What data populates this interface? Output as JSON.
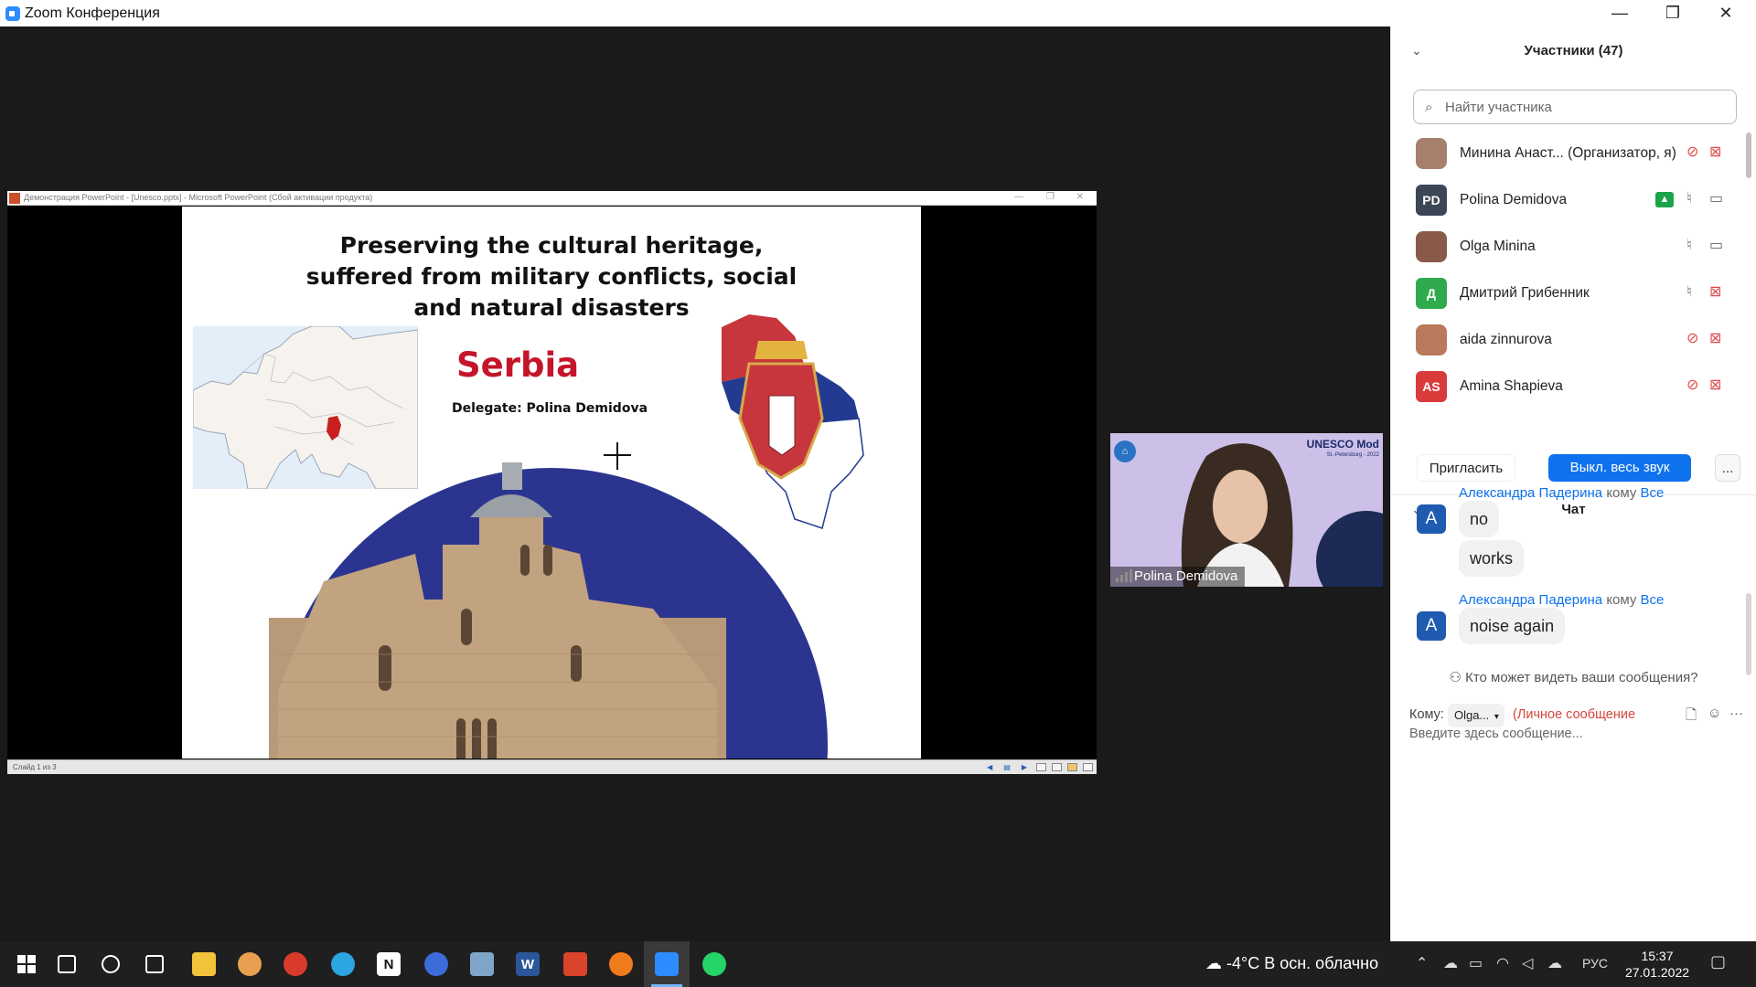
{
  "window": {
    "title": "Zoom Конференция",
    "controls": {
      "minimize": "—",
      "restore": "❐",
      "close": "✕"
    }
  },
  "powerpoint": {
    "title": "Демонстрация PowerPoint - [Unesco.pptx] - Microsoft PowerPoint (Сбой активации продукта)",
    "status": "Слайд 1 из 3",
    "slide": {
      "title_line1": "Preserving the cultural heritage,",
      "title_line2": "suffered from military conflicts, social",
      "title_line3": "and natural disasters",
      "country": "Serbia",
      "delegate": "Delegate: Polina Demidova"
    }
  },
  "video": {
    "name": "Polina Demidova",
    "brand": "UNESCO Mod",
    "brand_sub": "St.-Petersburg - 2022"
  },
  "participants": {
    "header": "Участники (47)",
    "search_placeholder": "Найти участника",
    "items": [
      {
        "name": "Минина Анаст...  (Организатор, я)",
        "avatar": "photo",
        "color": "#a7806c",
        "mic": "muted",
        "cam": "off"
      },
      {
        "name": "Polina Demidova",
        "avatar": "PD",
        "color": "#3b4757",
        "mic": "on",
        "cam": "on",
        "sharing": true
      },
      {
        "name": "Olga Minina",
        "avatar": "photo",
        "color": "#8a5a48",
        "mic": "on",
        "cam": "on"
      },
      {
        "name": "Дмитрий Грибенник",
        "avatar": "Д",
        "color": "#2faa4c",
        "mic": "on",
        "cam": "off"
      },
      {
        "name": "aida zinnurova",
        "avatar": "photo",
        "color": "#b87a5a",
        "mic": "muted",
        "cam": "off"
      },
      {
        "name": "Amina Shapieva",
        "avatar": "AS",
        "color": "#d93b3b",
        "mic": "muted",
        "cam": "off"
      }
    ],
    "buttons": {
      "invite": "Пригласить",
      "mute_all": "Выкл. весь звук",
      "more": "..."
    }
  },
  "chat": {
    "header": "Чат",
    "messages": [
      {
        "sender": "Александра Падерина",
        "to_word": "кому",
        "recipient": "Все",
        "avatar": "A",
        "bubbles": [
          "no",
          "works"
        ]
      },
      {
        "sender": "Александра Падерина",
        "to_word": "кому",
        "recipient": "Все",
        "avatar": "A",
        "bubbles": [
          "noise again"
        ]
      }
    ],
    "who_can_see": "Кто может видеть ваши сообщения?",
    "to_label": "Кому:",
    "to_value": "Olga...",
    "private": "(Личное сообщение",
    "input_placeholder": "Введите здесь сообщение..."
  },
  "taskbar": {
    "weather": "-4°C  В осн. облачно",
    "lang": "РУС",
    "time": "15:37",
    "date": "27.01.2022",
    "apps": [
      {
        "icon": "windows-start-icon",
        "color": "#ffffff",
        "label": ""
      },
      {
        "icon": "search-icon",
        "color": "#ffffff",
        "label": ""
      },
      {
        "icon": "cortana-icon",
        "color": "#ffffff",
        "label": ""
      },
      {
        "icon": "task-view-icon",
        "color": "#ffffff",
        "label": ""
      },
      {
        "icon": "file-explorer-icon",
        "color": "#f2c43a",
        "label": ""
      },
      {
        "icon": "browser-icon",
        "color": "#e8a050",
        "label": ""
      },
      {
        "icon": "chrome-icon",
        "color": "#d93b2b",
        "label": ""
      },
      {
        "icon": "telegram-icon",
        "color": "#2ca5e0",
        "label": ""
      },
      {
        "icon": "notion-icon",
        "color": "#ffffff",
        "label": "N"
      },
      {
        "icon": "tasks-icon",
        "color": "#3b6cd9",
        "label": ""
      },
      {
        "icon": "photo-app-icon",
        "color": "#7fa6c9",
        "label": ""
      },
      {
        "icon": "word-icon",
        "color": "#2b579a",
        "label": "W"
      },
      {
        "icon": "ccleaner-icon",
        "color": "#d9442b",
        "label": ""
      },
      {
        "icon": "avast-icon",
        "color": "#f07b1a",
        "label": ""
      },
      {
        "icon": "zoom-icon",
        "color": "#2d8cff",
        "label": "",
        "active": true
      },
      {
        "icon": "whatsapp-icon",
        "color": "#25d366",
        "label": ""
      }
    ]
  }
}
